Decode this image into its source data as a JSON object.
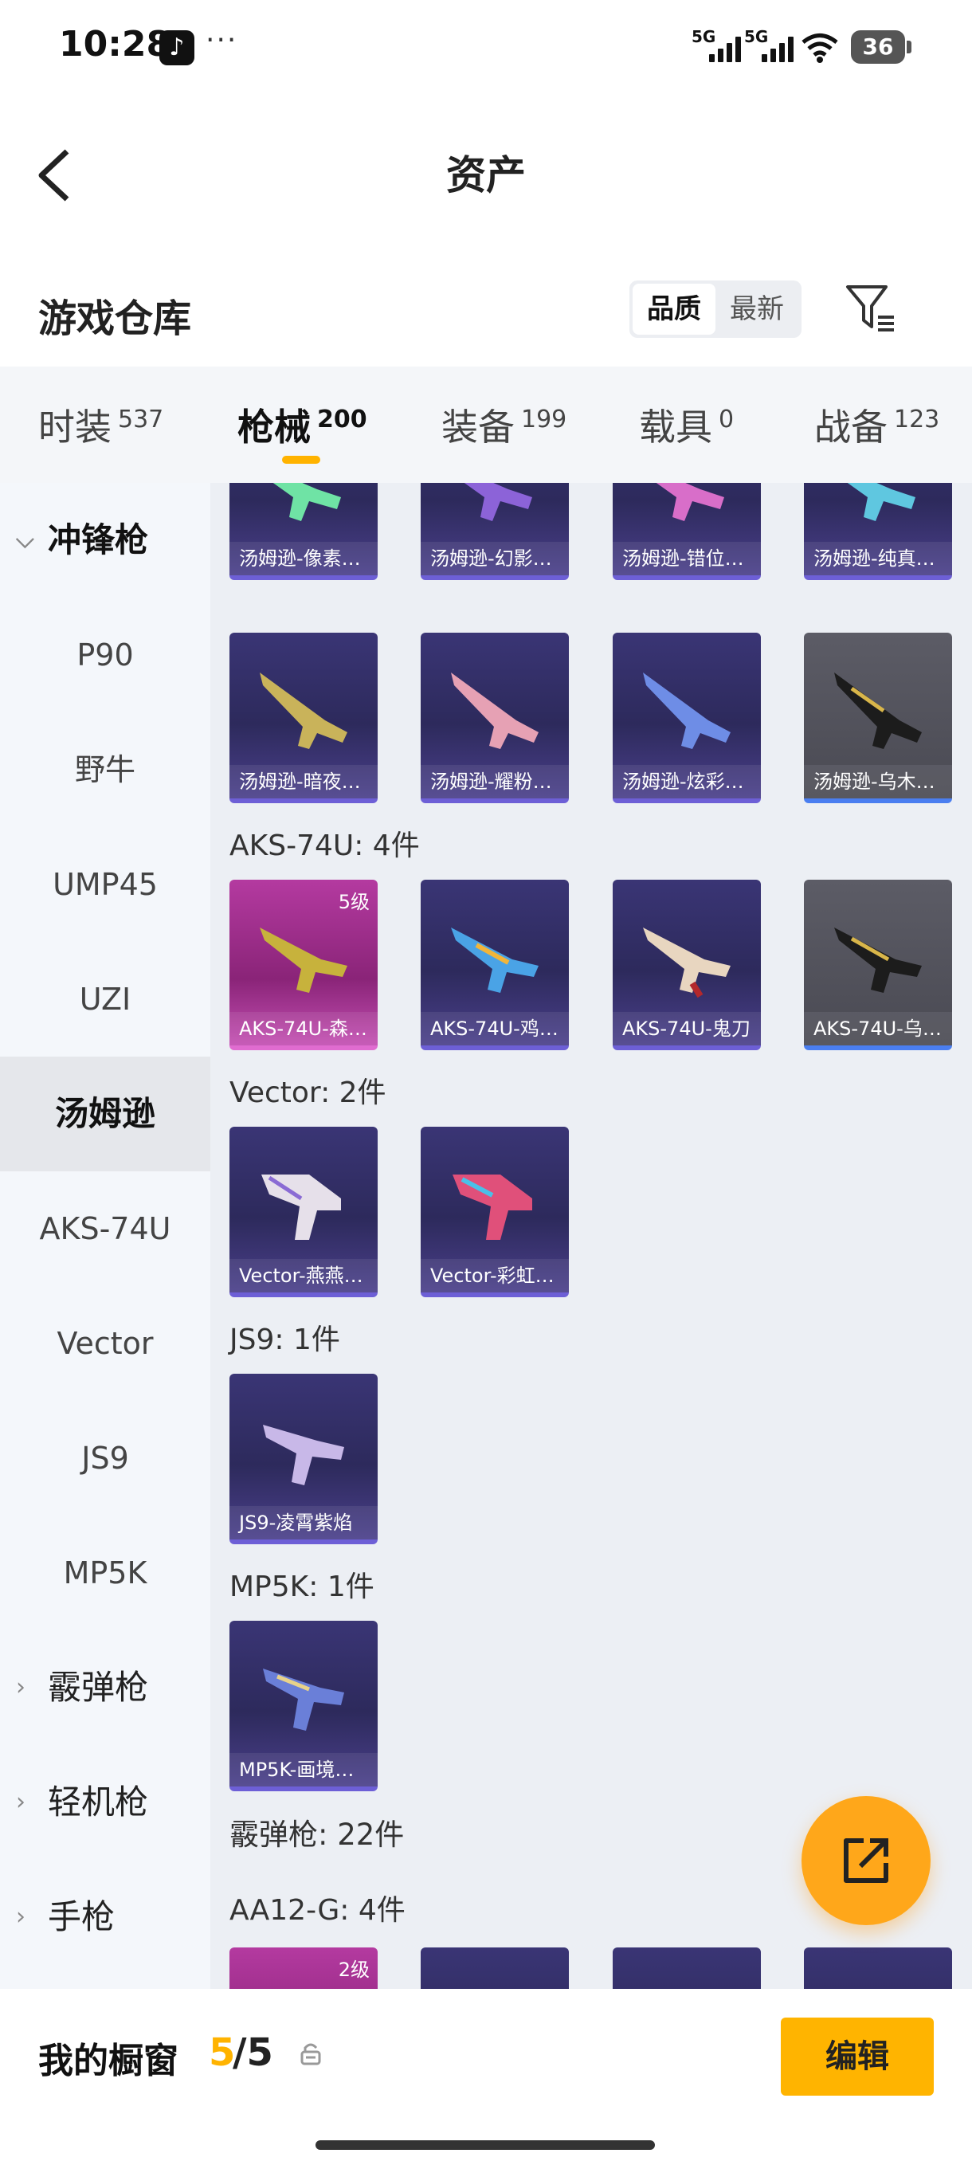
{
  "status_bar": {
    "time": "10:28",
    "more": "···",
    "signal1": "5G",
    "signal2": "5G",
    "battery": "36"
  },
  "nav": {
    "title": "资产"
  },
  "warehouse": {
    "title": "游戏仓库",
    "sort_options": [
      "品质",
      "最新"
    ],
    "active_sort": "品质"
  },
  "tabs": [
    {
      "label": "时装",
      "count": "537"
    },
    {
      "label": "枪械",
      "count": "200"
    },
    {
      "label": "装备",
      "count": "199"
    },
    {
      "label": "载具",
      "count": "0"
    },
    {
      "label": "战备",
      "count": "123"
    }
  ],
  "active_tab": "枪械",
  "sidebar": [
    {
      "label": "冲锋枪",
      "type": "category",
      "chevron": "chevron-down-icon"
    },
    {
      "label": "P90",
      "type": "item"
    },
    {
      "label": "野牛",
      "type": "item"
    },
    {
      "label": "UMP45",
      "type": "item"
    },
    {
      "label": "UZI",
      "type": "item"
    },
    {
      "label": "汤姆逊",
      "type": "item",
      "selected": true
    },
    {
      "label": "AKS-74U",
      "type": "item"
    },
    {
      "label": "Vector",
      "type": "item"
    },
    {
      "label": "JS9",
      "type": "item"
    },
    {
      "label": "MP5K",
      "type": "item"
    },
    {
      "label": "霰弹枪",
      "type": "category",
      "chevron": "chevron-right-icon"
    },
    {
      "label": "轻机枪",
      "type": "category",
      "chevron": "chevron-right-icon"
    },
    {
      "label": "手枪",
      "type": "category",
      "chevron": "chevron-right-icon"
    }
  ],
  "content": {
    "row0": [
      "汤姆逊-像素…",
      "汤姆逊-幻影…",
      "汤姆逊-错位…",
      "汤姆逊-纯真…"
    ],
    "row1": [
      "汤姆逊-暗夜…",
      "汤姆逊-耀粉…",
      "汤姆逊-炫彩…",
      "汤姆逊-乌木…"
    ],
    "aks_header": "AKS-74U: 4件",
    "aks": [
      {
        "name": "AKS-74U-森…",
        "level": "5级"
      },
      {
        "name": "AKS-74U-鸡…",
        "level": ""
      },
      {
        "name": "AKS-74U-鬼刀",
        "level": ""
      },
      {
        "name": "AKS-74U-乌…",
        "level": ""
      }
    ],
    "vector_header": "Vector: 2件",
    "vector": [
      "Vector-燕燕…",
      "Vector-彩虹…"
    ],
    "js9_header": "JS9: 1件",
    "js9": [
      "JS9-凌霄紫焰"
    ],
    "mp5k_header": "MP5K: 1件",
    "mp5k": [
      "MP5K-画境…"
    ],
    "shotgun_header": "霰弹枪: 22件",
    "aa12_header": "AA12-G: 4件",
    "aa12_level": "2级"
  },
  "bottom_bar": {
    "title": "我的橱窗",
    "count_current": "5",
    "count_total": "/5",
    "edit_label": "编辑"
  },
  "colors": {
    "accent": "#ffb300",
    "fab": "#ffa71a",
    "card_purple": "#2d2a5c",
    "card_pink": "#8a2478",
    "card_grey": "#4a4a53"
  }
}
